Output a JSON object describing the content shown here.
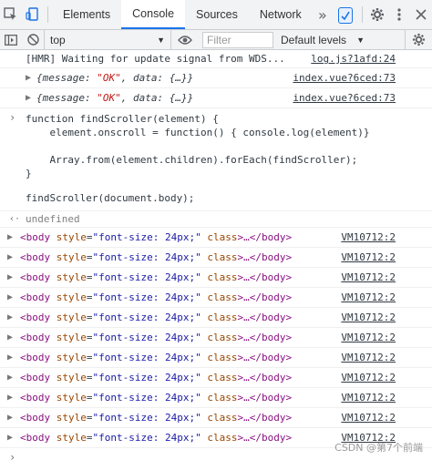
{
  "tabs": [
    {
      "label": "Elements"
    },
    {
      "label": "Console"
    },
    {
      "label": "Sources"
    },
    {
      "label": "Network"
    }
  ],
  "more_tabs_label": "»",
  "toolbar": {
    "context_value": "top",
    "filter_placeholder": "Filter",
    "levels_label": "Default levels"
  },
  "console": {
    "hmr_message": "[HMR] Waiting for update signal from WDS...",
    "hmr_link": "log.js?1afd:24",
    "obj_rows": [
      {
        "text_open": "{message: ",
        "str": "\"OK\"",
        "text_close": ", data: {…}}",
        "link": "index.vue?6ced:73"
      },
      {
        "text_open": "{message: ",
        "str": "\"OK\"",
        "text_close": ", data: {…}}",
        "link": "index.vue?6ced:73"
      }
    ],
    "code_lines": [
      "function findScroller(element) {",
      "    element.onscroll = function() { console.log(element)}",
      "",
      "    Array.from(element.children).forEach(findScroller);",
      "}"
    ],
    "call_line": "findScroller(document.body);",
    "undefined_text": "undefined",
    "body_logs": {
      "tag_open": "<body",
      "attr_name": " style",
      "attr_val": "\"font-size: 24px;\"",
      "class_attr": " class",
      "ellipsis": ">…</",
      "tag_close": "body>",
      "link": "VM10712:2",
      "count": 11
    }
  },
  "watermark": "CSDN @第7个前端"
}
